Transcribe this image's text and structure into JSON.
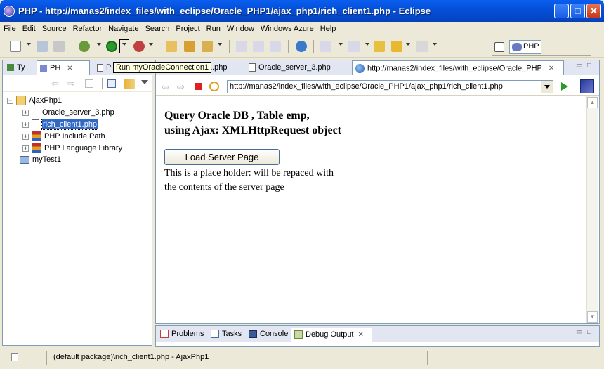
{
  "window": {
    "title": "PHP - http://manas2/index_files/with_eclipse/Oracle_PHP1/ajax_php1/rich_client1.php - Eclipse",
    "minimize_glyph": "_",
    "maximize_glyph": "□",
    "close_glyph": "✕"
  },
  "menu": [
    "File",
    "Edit",
    "Source",
    "Refactor",
    "Navigate",
    "Search",
    "Project",
    "Run",
    "Window",
    "Windows Azure",
    "Help"
  ],
  "perspective": {
    "label": "PHP"
  },
  "left_view": {
    "tabs": [
      {
        "label": "Ty"
      },
      {
        "label": "PH"
      },
      {
        "label": "P"
      }
    ],
    "tooltip": "Run myOracleConnection1",
    "tree": [
      {
        "label": "AjaxPhp1",
        "expander": "−"
      },
      {
        "label": "Oracle_server_3.php",
        "expander": "+"
      },
      {
        "label": "rich_client1.php",
        "expander": "+"
      },
      {
        "label": "PHP Include Path",
        "expander": "+"
      },
      {
        "label": "PHP Language Library",
        "expander": "+"
      },
      {
        "label": "myTest1",
        "expander": ""
      }
    ]
  },
  "editor": {
    "tabs": [
      {
        "label": "1.php"
      },
      {
        "label": "Oracle_server_3.php"
      },
      {
        "label": "http://manas2/index_files/with_eclipse/Oracle_PHP"
      }
    ],
    "url": "http://manas2/index_files/with_eclipse/Oracle_PHP1/ajax_php1/rich_client1.php",
    "page": {
      "heading_line1": "Query Oracle DB , Table emp,",
      "heading_line2": "using Ajax: XMLHttpRequest object",
      "button_label": "Load Server Page",
      "placeholder_line1": "This is a place holder: will be repaced with",
      "placeholder_line2": "the contents of the server page"
    }
  },
  "bottom_view": {
    "tabs": [
      {
        "label": "Problems"
      },
      {
        "label": "Tasks"
      },
      {
        "label": "Console"
      },
      {
        "label": "Debug Output"
      }
    ]
  },
  "status": {
    "text": "(default package)\\rich_client1.php - AjaxPhp1"
  },
  "colors": {
    "titlebar": "#0450d8",
    "selection": "#316ac5",
    "tab_bg": "#e1e6f2"
  }
}
